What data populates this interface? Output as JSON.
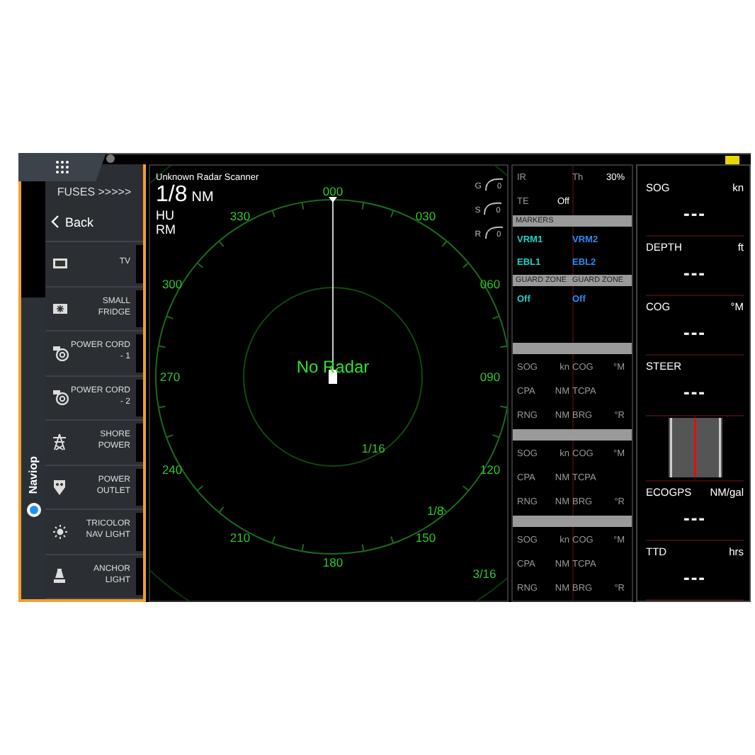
{
  "left_panel": {
    "tab_label": "Naviop",
    "title": "FUSES >>>>>",
    "back": "Back",
    "items": [
      {
        "label": "TV"
      },
      {
        "label": "SMALL\nFRIDGE"
      },
      {
        "label": "POWER CORD\n- 1"
      },
      {
        "label": "POWER CORD\n- 2"
      },
      {
        "label": "SHORE\nPOWER"
      },
      {
        "label": "POWER\nOUTLET"
      },
      {
        "label": "TRICOLOR\nNAV LIGHT"
      },
      {
        "label": "ANCHOR\nLIGHT"
      }
    ]
  },
  "radar": {
    "source": "Unknown Radar Scanner",
    "range": "1/8",
    "range_unit": "NM",
    "orientation": "HU",
    "motion": "RM",
    "status": "No Radar",
    "gauges": [
      {
        "label": "G",
        "value": "0"
      },
      {
        "label": "S",
        "value": "0"
      },
      {
        "label": "R",
        "value": "0"
      }
    ],
    "bearings": [
      "000",
      "330",
      "030",
      "300",
      "060",
      "270",
      "090",
      "240",
      "120",
      "210",
      "150",
      "180"
    ],
    "rings": [
      "1/16",
      "1/8",
      "3/16"
    ]
  },
  "data_panel": {
    "rows": [
      {
        "kind": "quad",
        "left_label": "IR",
        "right_label": "Th",
        "right_value": "30%"
      },
      {
        "kind": "quad",
        "left_label": "TE",
        "left_value": "Off"
      },
      {
        "kind": "header",
        "labels": [
          "MARKERS"
        ]
      },
      {
        "kind": "pair",
        "left": {
          "text": "VRM1",
          "color": "#22d3c8"
        },
        "right": {
          "text": "VRM2",
          "color": "#2b8cf0"
        }
      },
      {
        "kind": "pair",
        "left": {
          "text": "EBL1",
          "color": "#22d3c8"
        },
        "right": {
          "text": "EBL2",
          "color": "#2b8cf0"
        }
      },
      {
        "kind": "header",
        "labels": [
          "GUARD ZONE",
          "GUARD ZONE"
        ]
      },
      {
        "kind": "pair",
        "left": {
          "text": "Off",
          "color": "#22d3c8"
        },
        "right": {
          "text": "Off",
          "color": "#2b8cf0"
        }
      },
      {
        "kind": "gap"
      },
      {
        "kind": "header"
      },
      {
        "kind": "quad",
        "left_label": "SOG",
        "left_value": "kn",
        "right_label": "COG",
        "right_value": "°M"
      },
      {
        "kind": "quad",
        "left_label": "CPA",
        "left_value": "NM",
        "right_label": "TCPA"
      },
      {
        "kind": "quad",
        "left_label": "RNG",
        "left_value": "NM",
        "right_label": "BRG",
        "right_value": "°R"
      },
      {
        "kind": "header"
      },
      {
        "kind": "quad",
        "left_label": "SOG",
        "left_value": "kn",
        "right_label": "COG",
        "right_value": "°M"
      },
      {
        "kind": "quad",
        "left_label": "CPA",
        "left_value": "NM",
        "right_label": "TCPA"
      },
      {
        "kind": "quad",
        "left_label": "RNG",
        "left_value": "NM",
        "right_label": "BRG",
        "right_value": "°R"
      },
      {
        "kind": "header"
      },
      {
        "kind": "quad",
        "left_label": "SOG",
        "left_value": "kn",
        "right_label": "COG",
        "right_value": "°M"
      },
      {
        "kind": "quad",
        "left_label": "CPA",
        "left_value": "NM",
        "right_label": "TCPA"
      },
      {
        "kind": "quad",
        "left_label": "RNG",
        "left_value": "NM",
        "right_label": "BRG",
        "right_value": "°R"
      }
    ]
  },
  "instruments": [
    {
      "kind": "value",
      "label": "SOG",
      "unit": "kn",
      "value": "---"
    },
    {
      "kind": "value",
      "label": "DEPTH",
      "unit": "ft",
      "value": "---"
    },
    {
      "kind": "value",
      "label": "COG",
      "unit": "°M",
      "value": "---"
    },
    {
      "kind": "value",
      "label": "STEER",
      "value": "---"
    },
    {
      "kind": "steer"
    },
    {
      "kind": "value",
      "label": "ECOGPS",
      "unit": "NM/gal",
      "value": "---"
    },
    {
      "kind": "value",
      "label": "TTD",
      "unit": "hrs",
      "value": "---"
    }
  ]
}
